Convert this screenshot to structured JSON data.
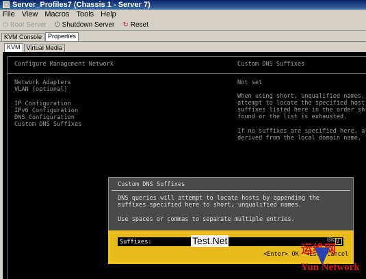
{
  "window": {
    "title": "Server_Profiles7 (Chassis 1 - Server 7)"
  },
  "menu": {
    "items": [
      "File",
      "View",
      "Macros",
      "Tools",
      "Help"
    ]
  },
  "toolbar": {
    "boot_server": "Boot Server",
    "shutdown_server": "Shutdown Server",
    "reset": "Reset"
  },
  "tabs_top": [
    "KVM Console",
    "Properties"
  ],
  "tabs_sub": [
    "KVM",
    "Virtual Media"
  ],
  "console": {
    "left_header": "Configure Management Network",
    "right_header": "Custom DNS Suffixes",
    "left_items": [
      "Network Adapters",
      "VLAN (optional)",
      "",
      "IP Configuration",
      "IPv6 Configuration",
      "DNS Configuration",
      "Custom DNS Suffixes"
    ],
    "right_status": "Not set",
    "right_desc": [
      "When using short, unqualified names,",
      "attempt to locate the specified host",
      "suffixes listed here in the order sh",
      "found or the list is exhausted."
    ],
    "right_desc2": [
      "If no suffixes are specified here, a",
      "derived from the local domain name."
    ]
  },
  "dialog": {
    "title": "Custom DNS Suffixes",
    "line1": "DNS queries will attempt to locate hosts by appending the",
    "line2": "suffixes specified here to short, unqualified names.",
    "line3": "Use spaces or commas to separate multiple entries.",
    "field_label": "Suffixes:",
    "field_value": "Test.Net",
    "buttons": "<Enter> OK  <Esc> Cancel"
  },
  "watermark": {
    "cn": "运维网",
    "en": "Yun Network",
    "blog": "Blog"
  }
}
